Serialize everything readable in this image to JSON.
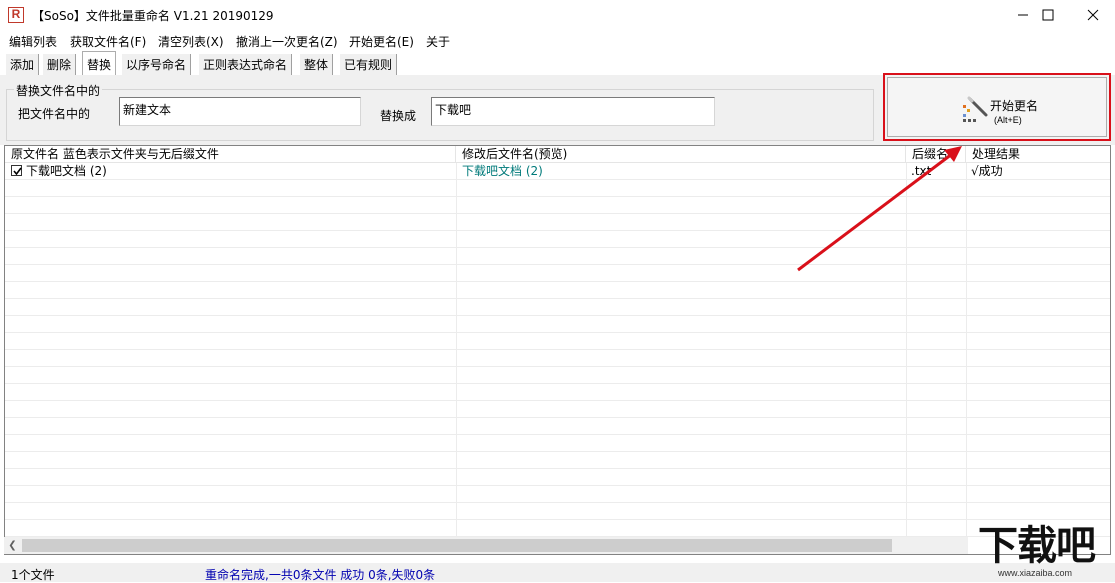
{
  "window": {
    "title": "【SoSo】文件批量重命名   V1.21 20190129",
    "icon_letter": "R"
  },
  "menu": [
    "编辑列表",
    "获取文件名(F)",
    "清空列表(X)",
    "撤消上一次更名(Z)",
    "开始更名(E)",
    "关于"
  ],
  "tabs": [
    "添加",
    "删除",
    "替换",
    "以序号命名",
    "正则表达式命名",
    "整体",
    "已有规则"
  ],
  "active_tab": "替换",
  "replace_panel": {
    "group_title": "替换文件名中的",
    "find_label": "把文件名中的",
    "find_value": "新建文本",
    "replace_label": "替换成",
    "replace_value": "下载吧"
  },
  "start_button": {
    "label": "开始更名",
    "shortcut": "(Alt+E)"
  },
  "table": {
    "columns": [
      "原文件名  蓝色表示文件夹与无后缀文件",
      "修改后文件名(预览)",
      "后缀名",
      "处理结果"
    ],
    "rows": [
      {
        "checked": true,
        "original": "下载吧文档 (2)",
        "preview": "下载吧文档 (2)",
        "ext": ".txt",
        "result": "√成功"
      }
    ]
  },
  "status": {
    "file_count": "1个文件",
    "message": "重命名完成,一共0条文件 成功 0条,失败0条"
  },
  "watermark": {
    "big": "下载吧",
    "small": "www.xiazaiba.com"
  },
  "colors": {
    "highlight_box": "#d9101a",
    "arrow": "#d9101a",
    "preview_text": "#007a7a",
    "status_text": "#0000b0"
  }
}
